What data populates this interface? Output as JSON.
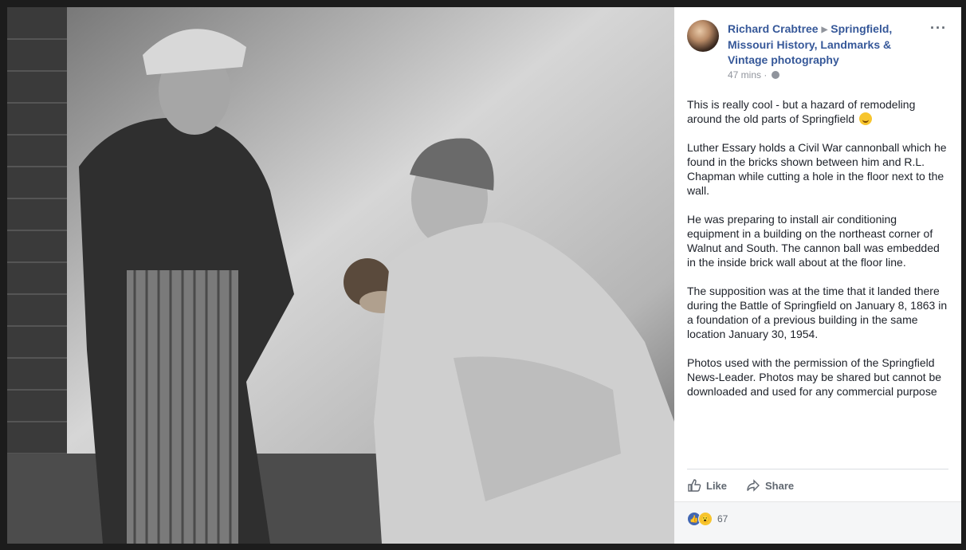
{
  "post": {
    "author": "Richard Crabtree",
    "group": "Springfield, Missouri History, Landmarks & Vintage photography",
    "time": "47 mins",
    "separator": "·",
    "more_label": "···",
    "paragraphs": [
      "This is really cool - but a hazard of remodeling around the old parts of Springfield",
      "Luther Essary holds a Civil War cannonball which he found in the bricks shown between him and R.L. Chapman while cutting a hole in the floor next to the wall.",
      "He was preparing to install air conditioning equipment in a building on the northeast corner of Walnut and South. The cannon ball was embedded in the inside brick wall about at the floor line.",
      "The supposition was at the time that it landed there during the Battle of Springfield on January 8, 1863 in a foundation of a previous building in the same location January 30, 1954.",
      "Photos used with the permission of the Springfield News-Leader. Photos may be shared but cannot be downloaded and used for any commercial purpose"
    ]
  },
  "actions": {
    "like_label": "Like",
    "share_label": "Share"
  },
  "reactions": {
    "count": "67"
  },
  "icons": {
    "like": "thumbs-up-icon",
    "share": "share-arrow-icon",
    "privacy": "globe-icon",
    "menu": "more-options-icon"
  },
  "colors": {
    "link": "#365899",
    "muted": "#90949c",
    "text": "#1d2129",
    "like_blue": "#4267b2"
  }
}
